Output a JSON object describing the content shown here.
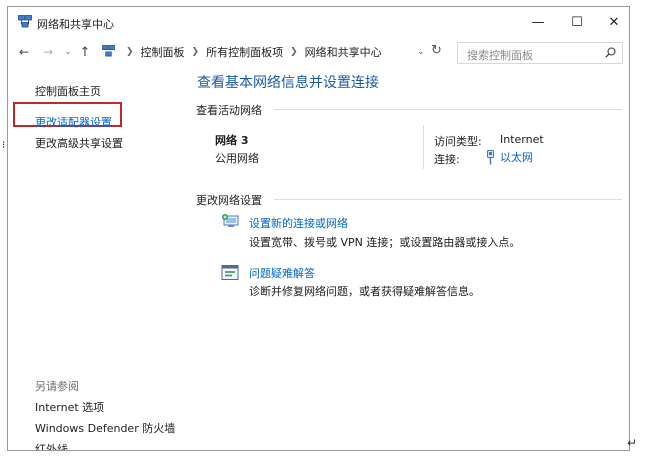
{
  "window": {
    "title": "网络和共享中心",
    "controls": {
      "minimize": "—",
      "maximize": "☐",
      "close": "✕"
    }
  },
  "address_bar": {
    "back": "←",
    "forward": "→",
    "recent": "⌄",
    "up": "↑",
    "breadcrumbs": [
      "控制面板",
      "所有控制面板项",
      "网络和共享中心"
    ],
    "dropdown": "⌄",
    "refresh": "↻",
    "search_placeholder": "搜索控制面板"
  },
  "sidebar": {
    "home": "控制面板主页",
    "adapter_settings": "更改适配器设置",
    "advanced_sharing": "更改高级共享设置",
    "see_also_title": "另请参阅",
    "see_also": [
      "Internet 选项",
      "Windows Defender 防火墙",
      "红外线"
    ]
  },
  "main": {
    "title": "查看基本网络信息并设置连接",
    "active_networks_header": "查看活动网络",
    "network": {
      "name": "网络  3",
      "type": "公用网络",
      "access_type_label": "访问类型:",
      "access_type_value": "Internet",
      "connection_label": "连接:",
      "connection_value": "以太网"
    },
    "change_settings_header": "更改网络设置",
    "tasks": [
      {
        "link": "设置新的连接或网络",
        "desc": "设置宽带、拨号或 VPN 连接；或设置路由器或接入点。"
      },
      {
        "link": "问题疑难解答",
        "desc": "诊断并修复网络问题，或者获得疑难解答信息。"
      }
    ]
  },
  "colors": {
    "link": "#0066cc",
    "title": "#1b5ba8",
    "highlight_box": "#c0282a"
  },
  "page_glyphs": {
    "return_mark": "↵",
    "left_tick": "⁝"
  }
}
